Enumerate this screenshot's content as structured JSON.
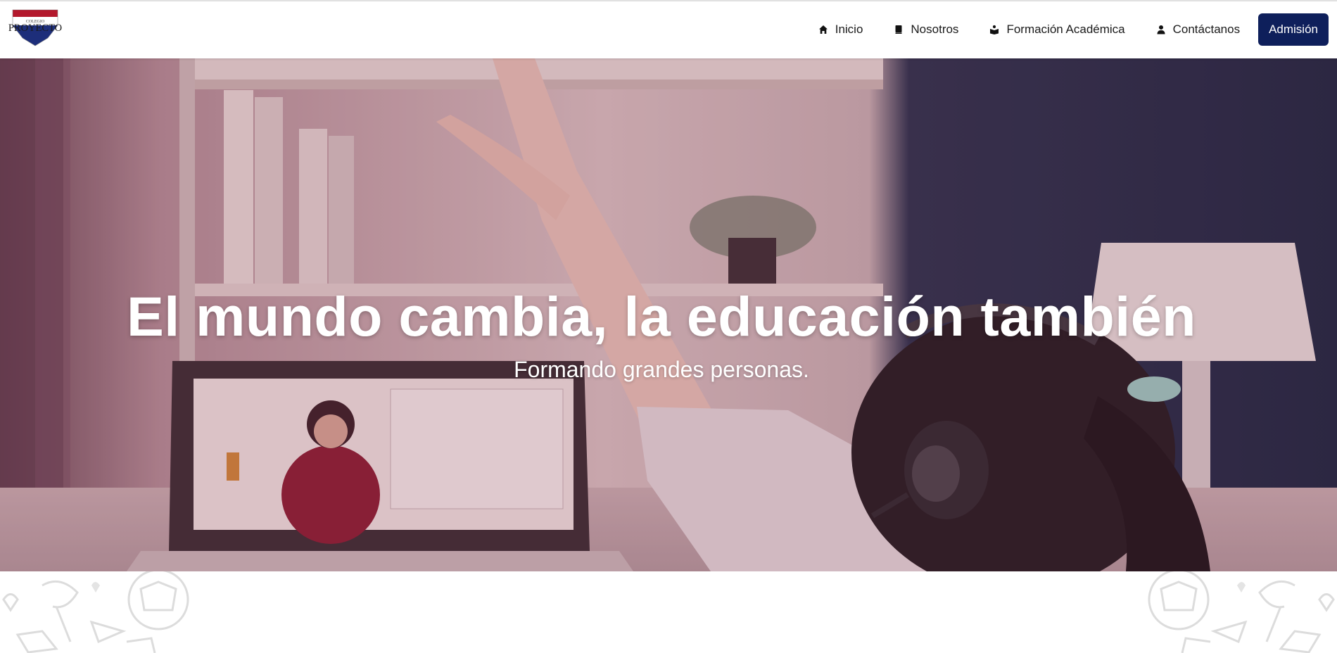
{
  "brand": {
    "logo_text_top": "COLEGIO",
    "logo_text_main": "PROYECTO",
    "colors": {
      "red": "#b3182c",
      "navy": "#1d2e7a"
    }
  },
  "nav": {
    "items": [
      {
        "label": "Inicio",
        "icon": "home-icon"
      },
      {
        "label": "Nosotros",
        "icon": "book-icon"
      },
      {
        "label": "Formación Académica",
        "icon": "reading-icon"
      },
      {
        "label": "Contáctanos",
        "icon": "user-icon"
      }
    ],
    "cta_label": "Admisión",
    "cta_color": "#0e1f5b"
  },
  "hero": {
    "title": "El mundo cambia, la educación también",
    "subtitle": "Formando grandes personas."
  }
}
